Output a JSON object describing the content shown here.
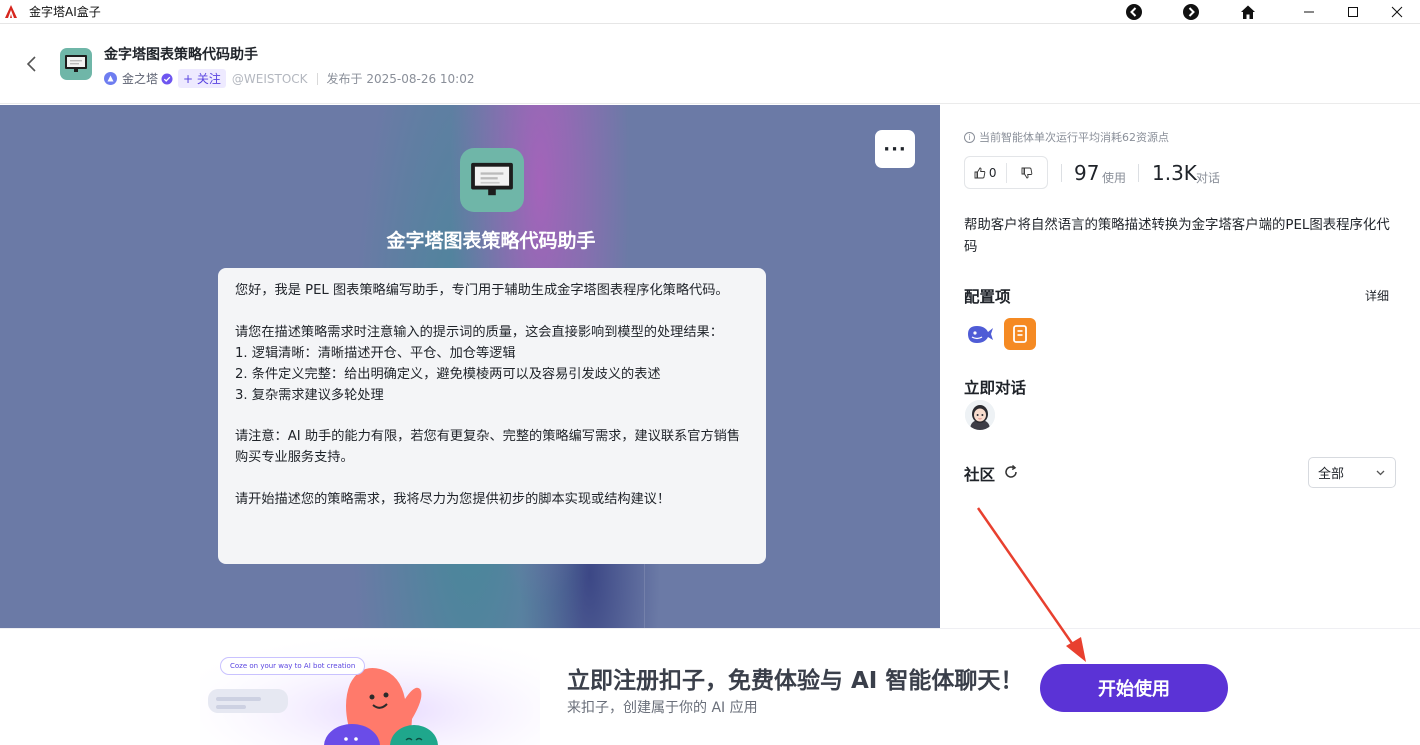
{
  "window": {
    "title": "金字塔AI盒子"
  },
  "header": {
    "bot_title": "金字塔图表策略代码助手",
    "author": "金之塔",
    "follow_label": "+ 关注",
    "handle": "@WEISTOCK",
    "published": "发布于 2025-08-26 10:02"
  },
  "preview": {
    "bot_name": "金字塔图表策略代码助手",
    "more_label": "···",
    "welcome_paragraphs": [
      "您好，我是 PEL 图表策略编写助手，专门用于辅助生成金字塔图表程序化策略代码。",
      "请您在描述策略需求时注意输入的提示词的质量，这会直接影响到模型的处理结果：\n1. 逻辑清晰：清晰描述开仓、平仓、加仓等逻辑\n2. 条件定义完整：给出明确定义，避免模棱两可以及容易引发歧义的表述\n3. 复杂需求建议多轮处理",
      "请注意：AI 助手的能力有限，若您有更复杂、完整的策略编写需求，建议联系官方销售购买专业服务支持。",
      "请开始描述您的策略需求，我将尽力为您提供初步的脚本实现或结构建议！"
    ]
  },
  "side": {
    "cost_note": "当前智能体单次运行平均消耗62资源点",
    "likes": "0",
    "uses_count": "97",
    "uses_label": "使用",
    "chats_count": "1.3K",
    "chats_label": "对话",
    "description": "帮助客户将自然语言的策略描述转换为金字塔客户端的PEL图表程序化代码",
    "config_title": "配置项",
    "detail_label": "详细",
    "chat_now_title": "立即对话",
    "community_title": "社区",
    "filter_value": "全部"
  },
  "promo": {
    "bubble_text": "Coze on your way to AI bot creation",
    "title": "立即注册扣子，免费体验与 AI 智能体聊天！",
    "subtitle": "来扣子，创建属于你的 AI 应用",
    "cta_label": "开始使用"
  },
  "colors": {
    "accent": "#5b33d6",
    "bot_avatar_bg": "#6fb6a8",
    "follow_bg": "#eeeaff",
    "preview_bg": "#6b7aa6",
    "arrow": "#e8402f"
  }
}
